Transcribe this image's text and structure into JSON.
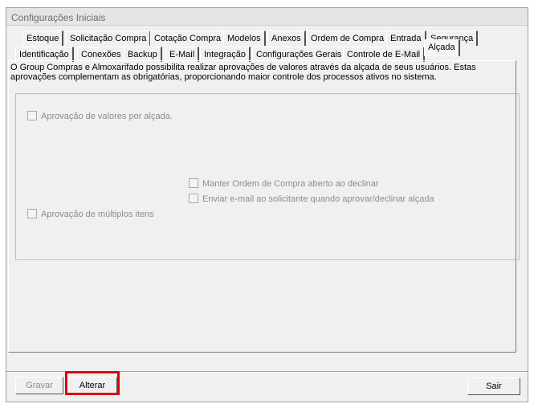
{
  "window": {
    "title": "Configurações Iniciais"
  },
  "tabs_row1": [
    "Estoque",
    "Solicitação Compra",
    "Cotação Compra",
    "Modelos",
    "Anexos",
    "Ordem de Compra",
    "Entrada",
    "Segurança"
  ],
  "tabs_row2": [
    "Identificação",
    "Conexões",
    "Backup",
    "E-Mail",
    "Integração",
    "Configurações Gerais",
    "Controle de E-Mail",
    "Alçada"
  ],
  "active_tab": "Alçada",
  "description": "O Group Compras e Almoxarifado possibilita realizar aprovações de valores através da alçada de seus usuários. Estas aprovações complementam as obrigatórias, proporcionando maior controle dos processos ativos no sistema.",
  "options": {
    "aprovacao_valores": {
      "label": "Aprovação de valores por alçada.",
      "checked": false
    },
    "manter_ordem": {
      "label": "Manter Ordem de Compra aberto ao declinar",
      "checked": false
    },
    "enviar_email": {
      "label": "Enviar e-mail ao solicitante quando aprovar/declinar alçada",
      "checked": false
    },
    "aprovacao_multiplos": {
      "label": "Aprovação de múltiplos itens",
      "checked": false
    }
  },
  "buttons": {
    "gravar": "Gravar",
    "alterar": "Alterar",
    "sair": "Sair"
  }
}
